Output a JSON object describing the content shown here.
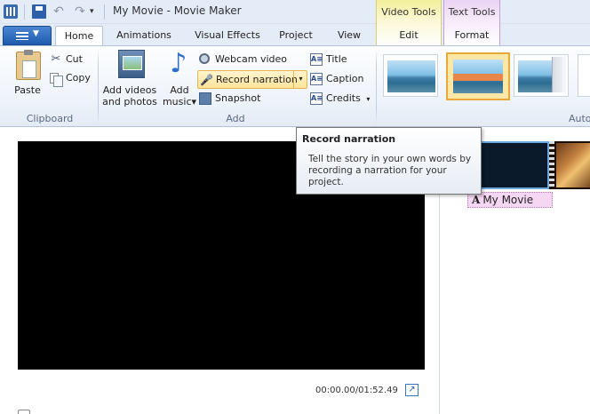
{
  "window": {
    "title": "My Movie - Movie Maker",
    "undo_glyph": "↶",
    "redo_glyph": "↷",
    "qat_more_glyph": "▾"
  },
  "contextual_groups": {
    "video_tools": "Video Tools",
    "text_tools": "Text Tools",
    "video_tools_color": "#f3ef9a",
    "text_tools_color": "#ead3f3"
  },
  "tabs": {
    "home": "Home",
    "animations": "Animations",
    "visual_effects": "Visual Effects",
    "project": "Project",
    "view": "View",
    "edit": "Edit",
    "format": "Format"
  },
  "ribbon": {
    "clipboard": {
      "label": "Clipboard",
      "paste": "Paste",
      "cut": "Cut",
      "copy": "Copy",
      "cut_glyph": "✂"
    },
    "add": {
      "label": "Add",
      "add_videos_line1": "Add videos",
      "add_videos_line2": "and photos",
      "add_music_line1": "Add",
      "add_music_line2": "music",
      "add_music_caret": "▾",
      "music_glyph": "♪",
      "webcam_video": "Webcam video",
      "record_narration": "Record narration",
      "record_narration_caret": "▾",
      "narration_glyph": "🎤",
      "snapshot": "Snapshot",
      "title": "Title",
      "caption": "Caption",
      "credits": "Credits",
      "credits_caret": "▾",
      "title_icon_text": "A≡",
      "caption_icon_text": "A≡",
      "credits_icon_text": "A≡"
    },
    "themes": {
      "label": "Auto"
    }
  },
  "tooltip": {
    "title": "Record narration",
    "body": "Tell the story in your own words by recording a narration for your project."
  },
  "preview": {
    "time": "00:00.00/01:52.49",
    "fullscreen_glyph": "↗"
  },
  "storyboard": {
    "caption_icon": "A",
    "caption_text": "My Movie"
  }
}
